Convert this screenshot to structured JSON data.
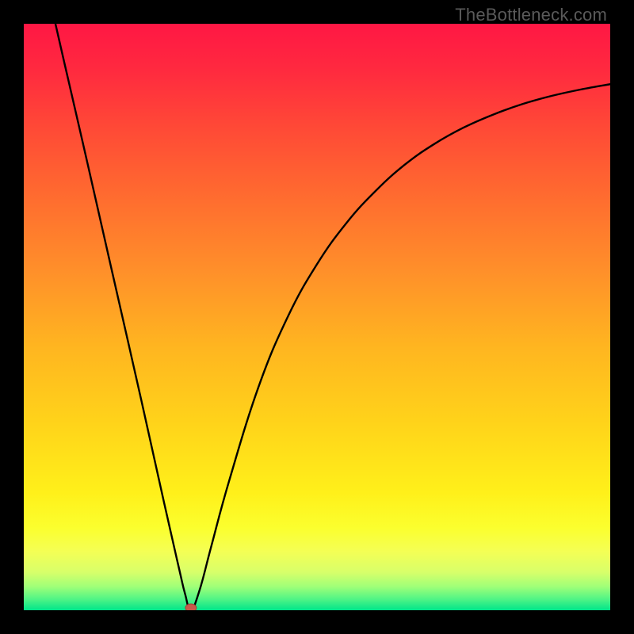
{
  "watermark": "TheBottleneck.com",
  "colors": {
    "black": "#000000",
    "curve": "#000000",
    "marker_fill": "#c85a4b",
    "marker_stroke": "#a24437"
  },
  "chart_data": {
    "type": "line",
    "title": "",
    "xlabel": "",
    "ylabel": "",
    "xlim": [
      0,
      100
    ],
    "ylim": [
      0,
      100
    ],
    "grid": false,
    "legend": false,
    "series": [
      {
        "name": "bottleneck-curve",
        "points": [
          {
            "x": 5.4,
            "y": 100.0
          },
          {
            "x": 7.0,
            "y": 93.0
          },
          {
            "x": 10.0,
            "y": 80.0
          },
          {
            "x": 15.0,
            "y": 58.0
          },
          {
            "x": 20.0,
            "y": 36.0
          },
          {
            "x": 24.0,
            "y": 18.0
          },
          {
            "x": 26.5,
            "y": 7.0
          },
          {
            "x": 27.5,
            "y": 2.8
          },
          {
            "x": 28.5,
            "y": 0.0
          },
          {
            "x": 30.0,
            "y": 3.5
          },
          {
            "x": 32.0,
            "y": 11.0
          },
          {
            "x": 35.0,
            "y": 22.0
          },
          {
            "x": 40.0,
            "y": 38.0
          },
          {
            "x": 45.0,
            "y": 50.0
          },
          {
            "x": 50.0,
            "y": 59.0
          },
          {
            "x": 55.0,
            "y": 66.0
          },
          {
            "x": 60.0,
            "y": 71.5
          },
          {
            "x": 65.0,
            "y": 76.0
          },
          {
            "x": 70.0,
            "y": 79.5
          },
          {
            "x": 75.0,
            "y": 82.3
          },
          {
            "x": 80.0,
            "y": 84.5
          },
          {
            "x": 85.0,
            "y": 86.3
          },
          {
            "x": 90.0,
            "y": 87.7
          },
          {
            "x": 95.0,
            "y": 88.8
          },
          {
            "x": 100.0,
            "y": 89.7
          }
        ]
      }
    ],
    "marker": {
      "x": 28.5,
      "y": 0.0
    },
    "gradient_stops": [
      {
        "offset": 0.0,
        "color": "#ff1744"
      },
      {
        "offset": 0.08,
        "color": "#ff2a3f"
      },
      {
        "offset": 0.18,
        "color": "#ff4a36"
      },
      {
        "offset": 0.3,
        "color": "#ff6d2f"
      },
      {
        "offset": 0.42,
        "color": "#ff8f2a"
      },
      {
        "offset": 0.55,
        "color": "#ffb520"
      },
      {
        "offset": 0.68,
        "color": "#ffd31a"
      },
      {
        "offset": 0.8,
        "color": "#fff01a"
      },
      {
        "offset": 0.86,
        "color": "#fbff2e"
      },
      {
        "offset": 0.9,
        "color": "#f4ff55"
      },
      {
        "offset": 0.935,
        "color": "#d8ff6a"
      },
      {
        "offset": 0.96,
        "color": "#9fff78"
      },
      {
        "offset": 0.98,
        "color": "#55f585"
      },
      {
        "offset": 1.0,
        "color": "#00e58a"
      }
    ]
  }
}
